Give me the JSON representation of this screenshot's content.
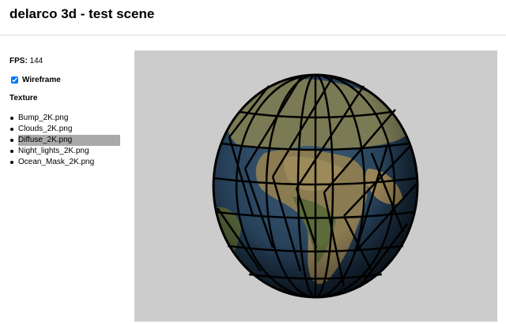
{
  "header": {
    "title": "delarco 3d - test scene"
  },
  "stats": {
    "fps_label": "FPS:",
    "fps_value": "144"
  },
  "options": {
    "wireframe_label": "Wireframe",
    "wireframe_checked": true
  },
  "texture": {
    "heading": "Texture",
    "items": [
      {
        "label": "Bump_2K.png",
        "selected": false
      },
      {
        "label": "Clouds_2K.png",
        "selected": false
      },
      {
        "label": "Diffuse_2K.png",
        "selected": true
      },
      {
        "label": "Night_lights_2K.png",
        "selected": false
      },
      {
        "label": "Ocean_Mask_2K.png",
        "selected": false
      }
    ]
  },
  "scene": {
    "background": "#cccccc",
    "object": "textured-earth-globe",
    "wireframe_color": "#000000"
  }
}
